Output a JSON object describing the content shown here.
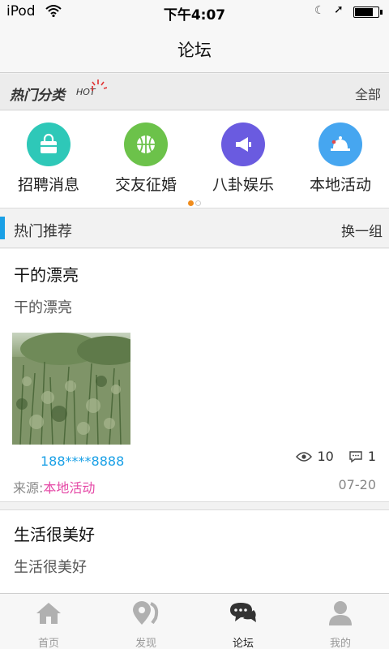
{
  "status_bar": {
    "carrier": "iPod",
    "time": "下午4:07",
    "battery_level": 0.72
  },
  "nav": {
    "title": "论坛"
  },
  "hot_categories": {
    "title": "热门分类",
    "tag": "HOT",
    "all_label": "全部",
    "items": [
      {
        "label": "招聘消息",
        "icon": "shopping-bag-icon",
        "color": "#2ec8b8"
      },
      {
        "label": "交友征婚",
        "icon": "basketball-icon",
        "color": "#6cc24a"
      },
      {
        "label": "八卦娱乐",
        "icon": "megaphone-icon",
        "color": "#6a5be0"
      },
      {
        "label": "本地活动",
        "icon": "bell-icon",
        "color": "#46a6f0"
      }
    ],
    "page_indicator": {
      "current": 1,
      "total": 2
    }
  },
  "recommend": {
    "title": "热门推荐",
    "refresh_label": "换一组"
  },
  "posts": [
    {
      "title": "干的漂亮",
      "body": "干的漂亮",
      "author": "188****8888",
      "views": "10",
      "comments": "1",
      "source_label": "来源:",
      "source_category": "本地活动",
      "date": "07-20"
    },
    {
      "title": "生活很美好",
      "body": "生活很美好"
    }
  ],
  "tabs": [
    {
      "label": "首页",
      "icon": "home-icon",
      "active": false
    },
    {
      "label": "发现",
      "icon": "location-pin-icon",
      "active": false
    },
    {
      "label": "论坛",
      "icon": "chat-bubbles-icon",
      "active": true
    },
    {
      "label": "我的",
      "icon": "user-icon",
      "active": false
    }
  ],
  "colors": {
    "accent": "#1aa0e6",
    "source_category": "#e54aa7",
    "page_dot_active": "#f08c1c"
  }
}
